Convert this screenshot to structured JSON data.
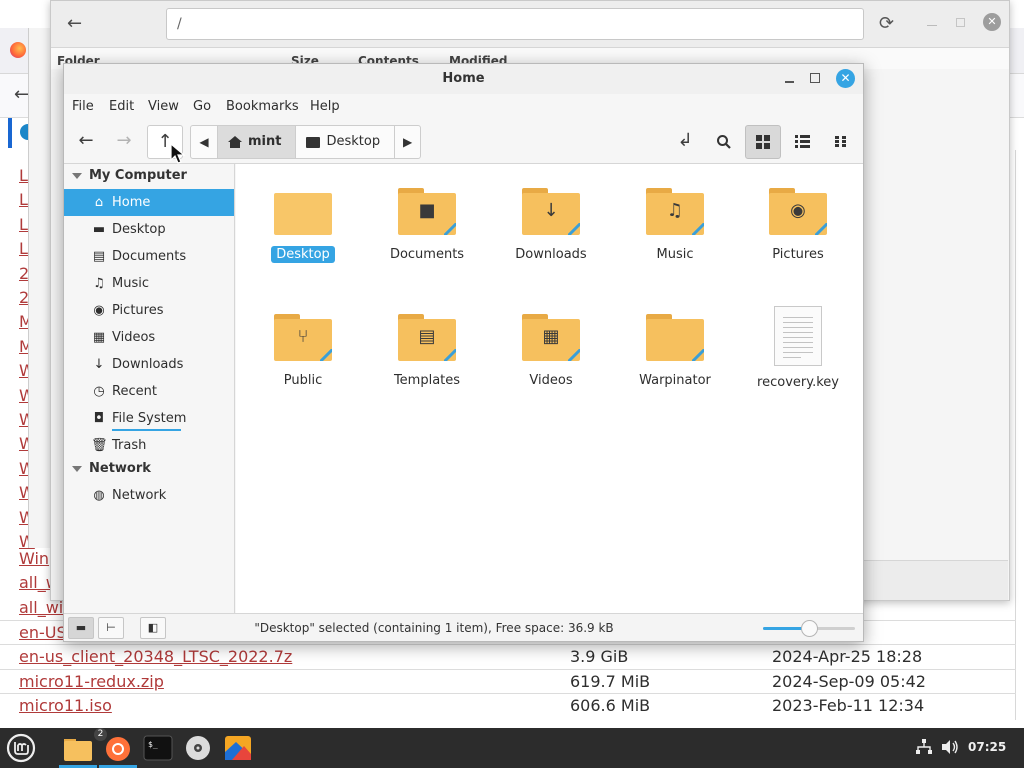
{
  "browser": {
    "back_icon": "back-arrow-icon",
    "left_letters": [
      "Li",
      "Li",
      "Li",
      "Li",
      "2",
      "2",
      "M",
      "M",
      "W",
      "W",
      "W",
      "W",
      "W",
      "W",
      "W",
      "W"
    ],
    "rows": [
      {
        "name": "Win",
        "size": "",
        "date": ""
      },
      {
        "name": "all_w",
        "size": "",
        "date": ""
      },
      {
        "name": "all_wi",
        "size": "",
        "date": "25 10:33"
      },
      {
        "name": "en-US",
        "size": "",
        "date": "3 03:57"
      },
      {
        "name": "en-us_client_20348_LTSC_2022.7z",
        "size": "3.9 GiB",
        "date": "2024-Apr-25 18:28"
      },
      {
        "name": "micro11-redux.zip",
        "size": "619.7 MiB",
        "date": "2024-Sep-09 05:42"
      },
      {
        "name": "micro11.iso",
        "size": "606.6 MiB",
        "date": "2023-Feb-11 12:34"
      }
    ]
  },
  "background_window": {
    "path": "/",
    "columns": {
      "folder": "Folder",
      "size": "Size",
      "contents": "Contents",
      "modified": "Modified"
    }
  },
  "window": {
    "title": "Home",
    "menu": [
      "File",
      "Edit",
      "View",
      "Go",
      "Bookmarks",
      "Help"
    ],
    "breadcrumbs": [
      {
        "label": "mint",
        "icon": "home-icon",
        "active": true
      },
      {
        "label": "Desktop",
        "icon": "desktop-icon",
        "active": false
      }
    ],
    "view_mode": "icons"
  },
  "sidebar": {
    "sections": [
      {
        "label": "My Computer",
        "items": [
          {
            "label": "Home",
            "icon": "home-icon",
            "selected": true
          },
          {
            "label": "Desktop",
            "icon": "desktop-icon"
          },
          {
            "label": "Documents",
            "icon": "document-icon"
          },
          {
            "label": "Music",
            "icon": "music-icon"
          },
          {
            "label": "Pictures",
            "icon": "camera-icon"
          },
          {
            "label": "Videos",
            "icon": "film-icon"
          },
          {
            "label": "Downloads",
            "icon": "download-icon"
          },
          {
            "label": "Recent",
            "icon": "clock-icon"
          },
          {
            "label": "File System",
            "icon": "drive-icon",
            "usage": 0.6
          },
          {
            "label": "Trash",
            "icon": "trash-icon"
          }
        ]
      },
      {
        "label": "Network",
        "items": [
          {
            "label": "Network",
            "icon": "globe-icon"
          }
        ]
      }
    ]
  },
  "files": [
    {
      "label": "Desktop",
      "type": "folder-plain",
      "glyph": "",
      "selected": true
    },
    {
      "label": "Documents",
      "type": "folder",
      "glyph": "■"
    },
    {
      "label": "Downloads",
      "type": "folder",
      "glyph": "↓"
    },
    {
      "label": "Music",
      "type": "folder",
      "glyph": "♫"
    },
    {
      "label": "Pictures",
      "type": "folder",
      "glyph": "◉"
    },
    {
      "label": "Public",
      "type": "folder",
      "glyph": "⑂"
    },
    {
      "label": "Templates",
      "type": "folder",
      "glyph": "▤"
    },
    {
      "label": "Videos",
      "type": "folder",
      "glyph": "▦"
    },
    {
      "label": "Warpinator",
      "type": "folder",
      "glyph": ""
    },
    {
      "label": "recovery.key",
      "type": "document",
      "glyph": ""
    }
  ],
  "status": {
    "text": "\"Desktop\" selected (containing 1 item), Free space: 36.9 kB",
    "zoom_level": 0.5
  },
  "taskbar": {
    "clock": "07:25",
    "badge": "2",
    "apps": [
      "mint-menu-icon",
      "files-icon",
      "firefox-icon",
      "terminal-icon",
      "disc-icon",
      "drawing-icon"
    ]
  },
  "colors": {
    "accent": "#35a4e3",
    "folder": "#f6c05e",
    "link": "#b03a3a"
  }
}
